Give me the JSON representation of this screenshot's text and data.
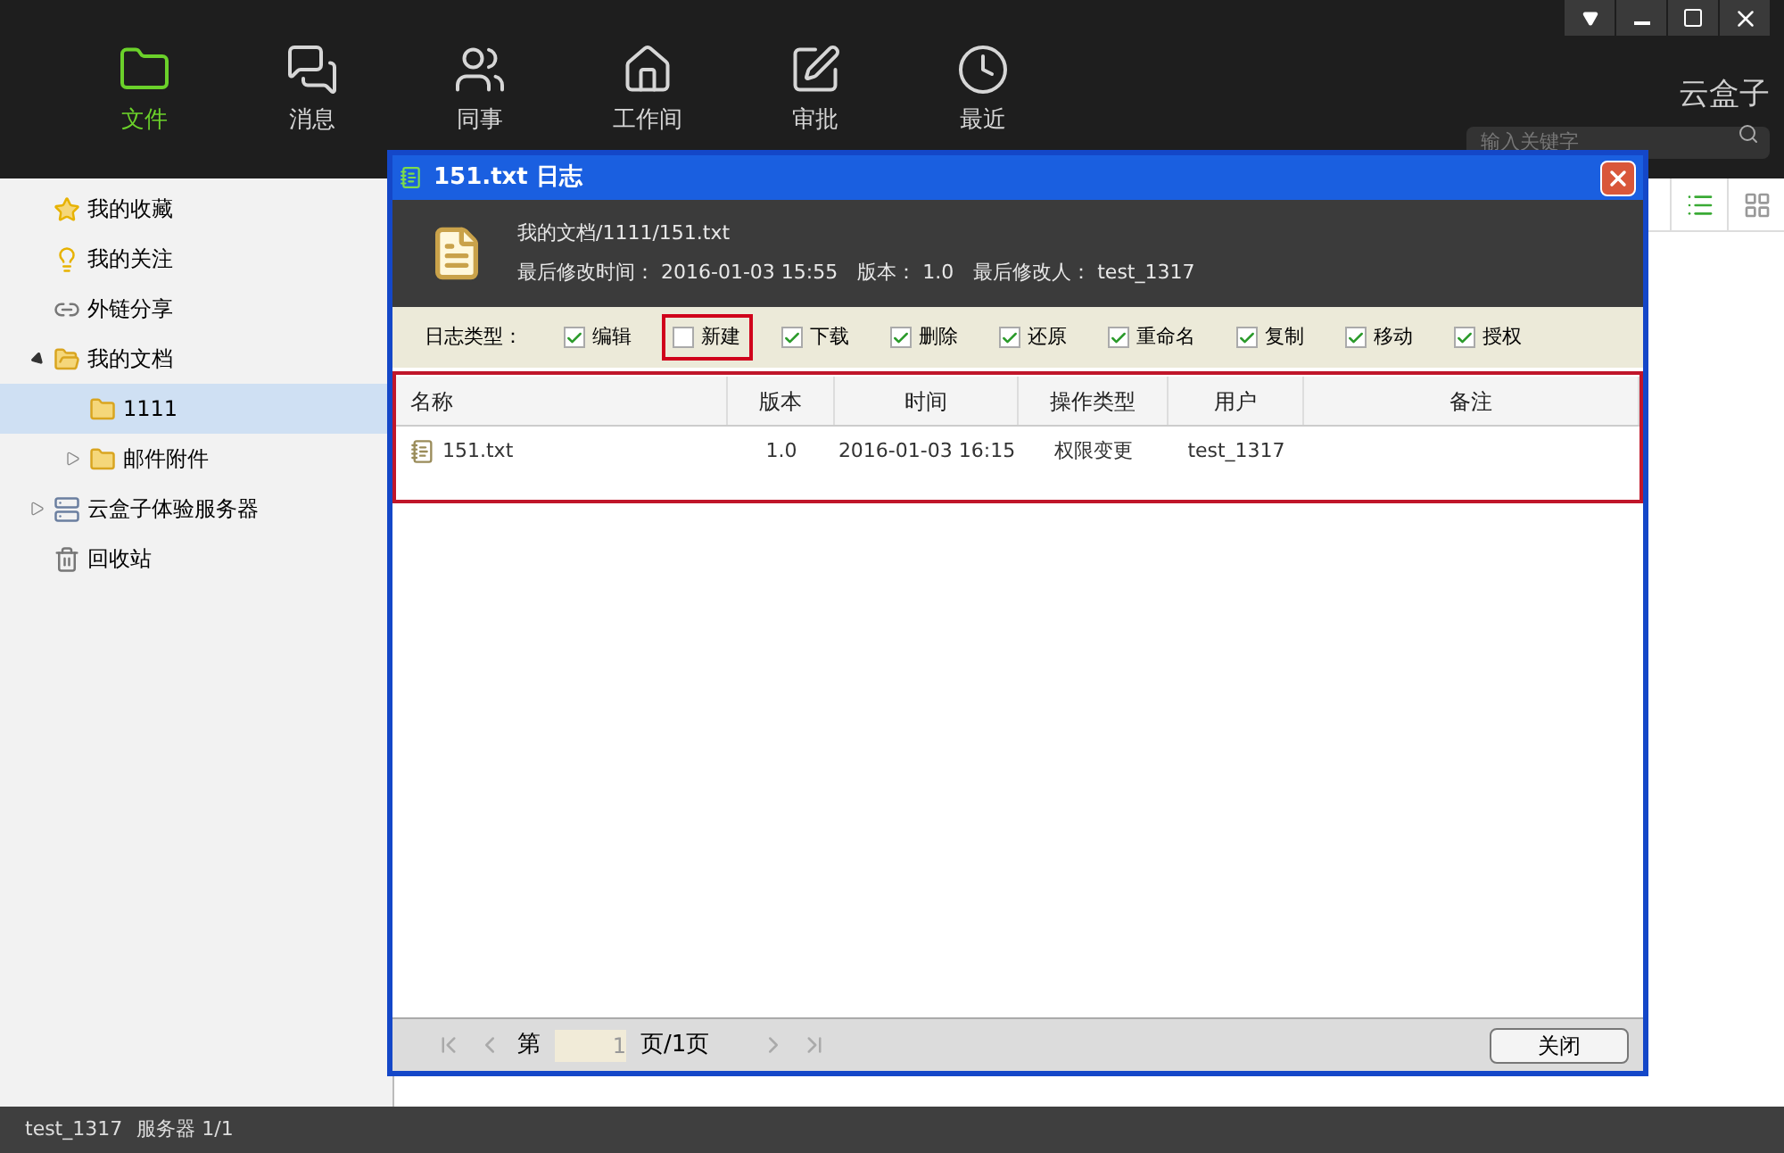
{
  "nav": [
    {
      "label": "文件",
      "selected": true
    },
    {
      "label": "消息",
      "selected": false
    },
    {
      "label": "同事",
      "selected": false
    },
    {
      "label": "工作间",
      "selected": false
    },
    {
      "label": "审批",
      "selected": false
    },
    {
      "label": "最近",
      "selected": false
    }
  ],
  "brand": "云盒子",
  "search": {
    "placeholder": "输入关键字"
  },
  "sidebar": [
    {
      "label": "我的收藏",
      "kind": "star",
      "selected": false
    },
    {
      "label": "我的关注",
      "kind": "bulb",
      "selected": false
    },
    {
      "label": "外链分享",
      "kind": "link",
      "selected": false
    },
    {
      "label": "我的文档",
      "kind": "userfolder",
      "selected": false,
      "expanded": true,
      "children": [
        {
          "label": "1111",
          "kind": "folder",
          "selected": true
        },
        {
          "label": "邮件附件",
          "kind": "folder",
          "selected": false,
          "expanded": false
        }
      ]
    },
    {
      "label": "云盒子体验服务器",
      "kind": "server",
      "selected": false,
      "expanded": false
    },
    {
      "label": "回收站",
      "kind": "trash",
      "selected": false
    }
  ],
  "view_toggle": [
    {
      "kind": "list",
      "selected": true
    },
    {
      "kind": "grid",
      "selected": false
    }
  ],
  "status_bar": {
    "user": "test_1317",
    "server": "服务器 1/1"
  },
  "dialog": {
    "title": "151.txt 日志",
    "path": "我的文档/1111/151.txt",
    "meta": "最后修改时间： 2016-01-03 15:55　版本： 1.0　最后修改人： test_1317",
    "filter_label": "日志类型：",
    "filters": [
      {
        "label": "编辑",
        "checked": true
      },
      {
        "label": "新建",
        "checked": false
      },
      {
        "label": "下载",
        "checked": true
      },
      {
        "label": "删除",
        "checked": true
      },
      {
        "label": "还原",
        "checked": true
      },
      {
        "label": "重命名",
        "checked": true
      },
      {
        "label": "复制",
        "checked": true
      },
      {
        "label": "移动",
        "checked": true
      },
      {
        "label": "授权",
        "checked": true
      }
    ],
    "table": {
      "columns": [
        "名称",
        "版本",
        "时间",
        "操作类型",
        "用户",
        "备注"
      ],
      "rows": [
        [
          "151.txt",
          "1.0",
          "2016-01-03 16:15",
          "权限变更",
          "test_1317",
          ""
        ]
      ]
    },
    "pager": {
      "prefix": "第",
      "page": "1",
      "suffix": "页/1页"
    },
    "close_button": "关闭"
  }
}
